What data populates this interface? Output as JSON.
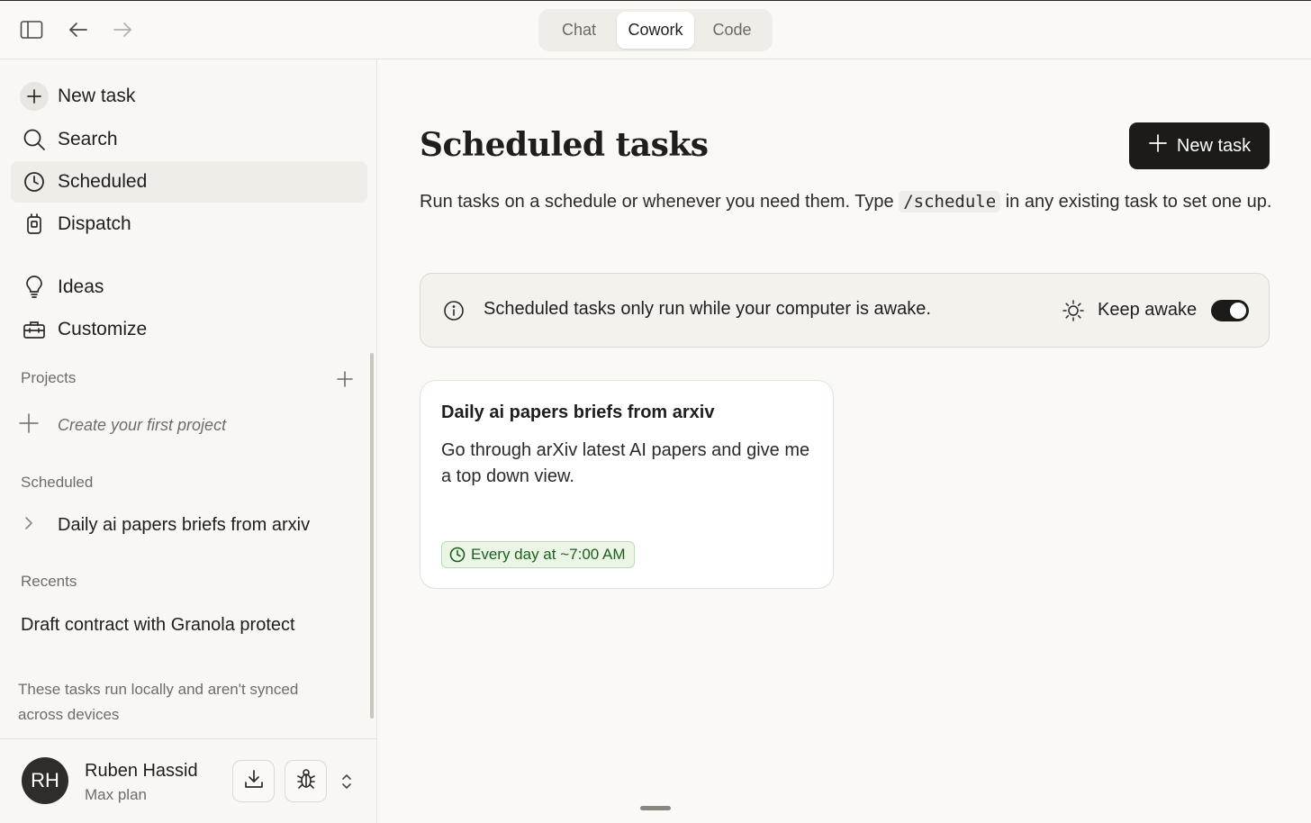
{
  "modes": {
    "tabs": [
      {
        "label": "Chat"
      },
      {
        "label": "Cowork"
      },
      {
        "label": "Code"
      }
    ],
    "active": "Cowork"
  },
  "sidebar": {
    "nav": [
      {
        "label": "New task",
        "icon": "plus-icon"
      },
      {
        "label": "Search",
        "icon": "search-icon"
      },
      {
        "label": "Scheduled",
        "icon": "clock-icon"
      },
      {
        "label": "Dispatch",
        "icon": "dispatch-icon"
      },
      {
        "label": "Ideas",
        "icon": "lightbulb-icon"
      },
      {
        "label": "Customize",
        "icon": "toolbox-icon"
      }
    ],
    "projects_label": "Projects",
    "create_project_label": "Create your first project",
    "scheduled_label": "Scheduled",
    "scheduled_items": [
      {
        "label": "Daily ai papers briefs from arxiv"
      }
    ],
    "recents_label": "Recents",
    "recents": [
      {
        "label": "Draft contract with Granola protect"
      }
    ],
    "sync_note": "These tasks run locally and aren't synced across devices",
    "user": {
      "initials": "RH",
      "name": "Ruben Hassid",
      "plan": "Max plan"
    }
  },
  "main": {
    "title": "Scheduled tasks",
    "new_task_label": "New task",
    "description_before": "Run tasks on a schedule or whenever you need them. Type ",
    "description_code": "/schedule",
    "description_after": " in any existing task to set one up.",
    "info_text": "Scheduled tasks only run while your computer is awake.",
    "keep_awake_label": "Keep awake",
    "keep_awake_on": true,
    "tasks": [
      {
        "title": "Daily ai papers briefs from arxiv",
        "description": "Go through arXiv latest AI papers and give me a top down view.",
        "schedule": "Every day at ~7:00 AM"
      }
    ]
  },
  "colors": {
    "accent": "#1c1b19",
    "badge_green": "#1d5e1f",
    "badge_bg": "#eaf5e6",
    "background": "#faf9f6"
  }
}
